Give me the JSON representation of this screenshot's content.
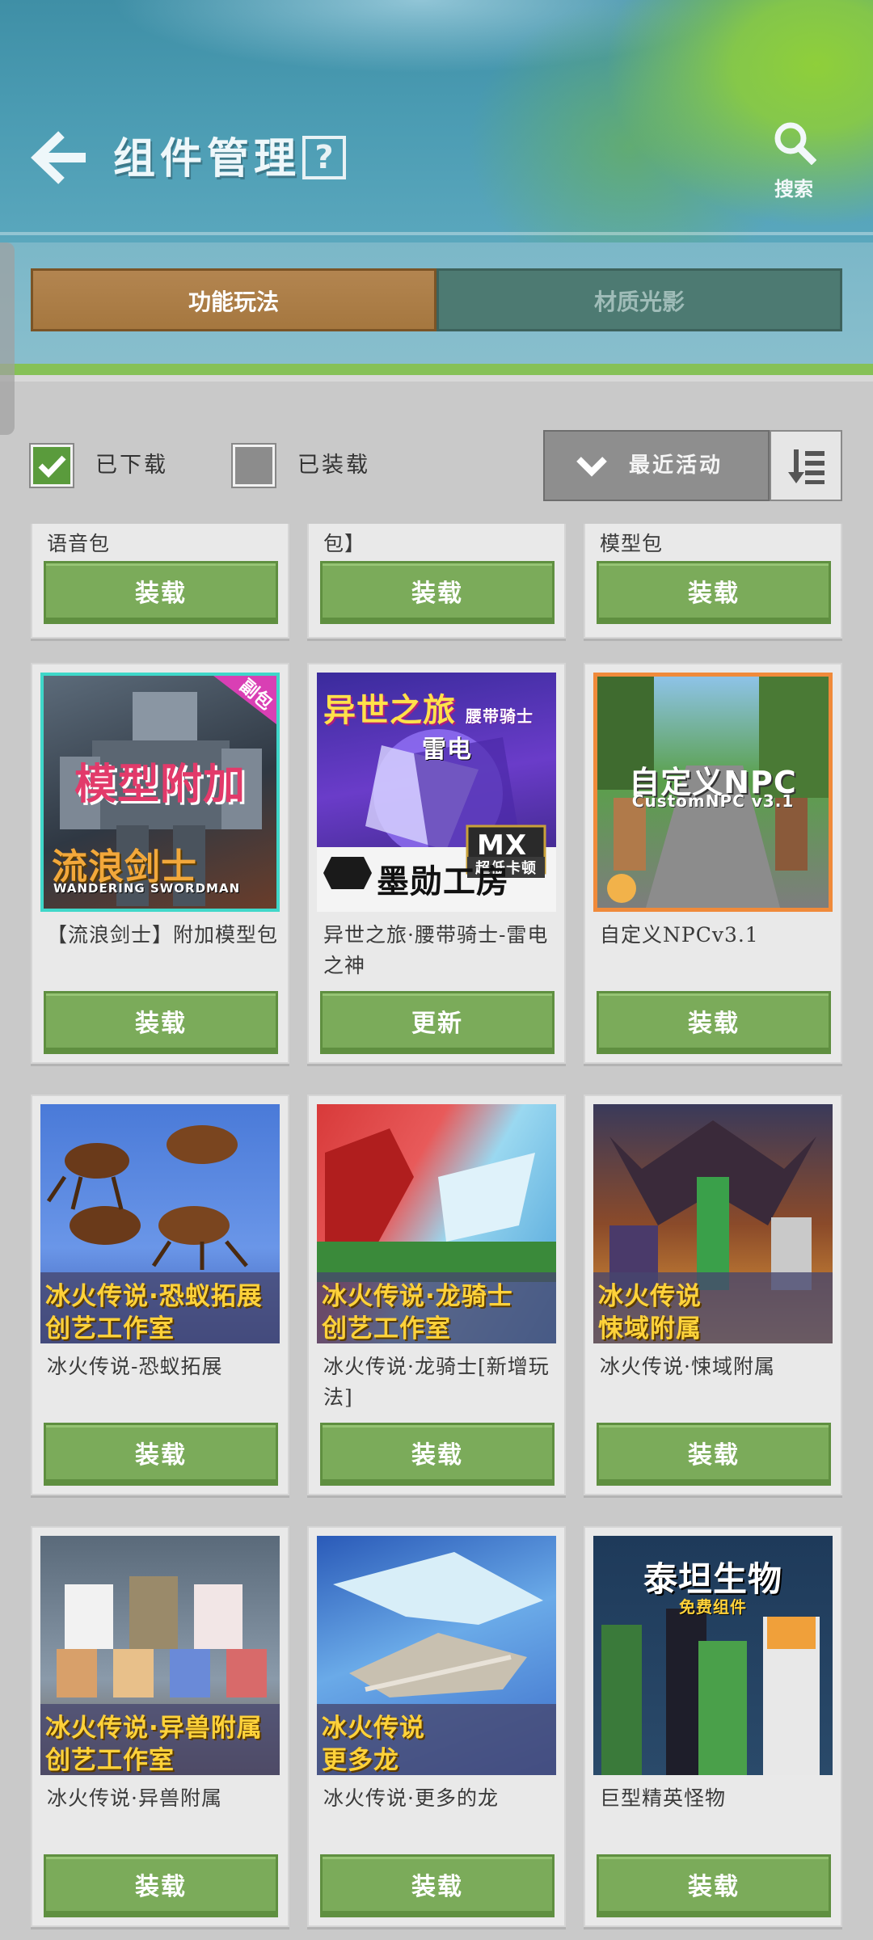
{
  "header": {
    "title": "组件管理",
    "help_label": "?",
    "search_label": "搜索"
  },
  "tabs": [
    {
      "label": "功能玩法",
      "active": true
    },
    {
      "label": "材质光影",
      "active": false
    }
  ],
  "filters": {
    "downloaded": {
      "label": "已下载",
      "checked": true
    },
    "loaded": {
      "label": "已装载",
      "checked": false
    },
    "sort": {
      "label": "最近活动"
    }
  },
  "colors": {
    "button_green": "#7bab5a",
    "tab_active": "#a5773f",
    "header_blue": "#4a9bb2"
  },
  "cards": [
    {
      "name": "语音包",
      "button": "装载"
    },
    {
      "name": "包】",
      "button": "装载"
    },
    {
      "name": "模型包",
      "button": "装载"
    },
    {
      "name": "【流浪剑士】附加模型包",
      "button": "装载",
      "thumb_text": [
        "模型附加",
        "流浪剑士",
        "WANDERING SWORDMAN",
        "副包"
      ]
    },
    {
      "name": "异世之旅·腰带骑士-雷电之神",
      "button": "更新",
      "thumb_text": [
        "异世之旅",
        "腰带骑士",
        "雷电",
        "墨勋工房",
        "超低卡顿",
        "MX"
      ]
    },
    {
      "name": "自定义NPCv3.1",
      "button": "装载",
      "thumb_text": [
        "自定义NPC",
        "CustomNPC v3.1"
      ]
    },
    {
      "name": "冰火传说-恐蚁拓展",
      "button": "装载",
      "thumb_text": [
        "冰火传说·恐蚁拓展",
        "创艺工作室"
      ]
    },
    {
      "name": "冰火传说·龙骑士[新增玩法]",
      "button": "装载",
      "thumb_text": [
        "冰火传说·龙骑士",
        "创艺工作室"
      ]
    },
    {
      "name": "冰火传说·悚域附属",
      "button": "装载",
      "thumb_text": [
        "冰火传说",
        "悚域附属"
      ]
    },
    {
      "name": "冰火传说·异兽附属",
      "button": "装载",
      "thumb_text": [
        "冰火传说·异兽附属",
        "创艺工作室"
      ]
    },
    {
      "name": "冰火传说·更多的龙",
      "button": "装载",
      "thumb_text": [
        "冰火传说",
        "更多龙"
      ]
    },
    {
      "name": "巨型精英怪物",
      "button": "装载",
      "thumb_text": [
        "泰坦生物",
        "免费组件"
      ]
    }
  ]
}
